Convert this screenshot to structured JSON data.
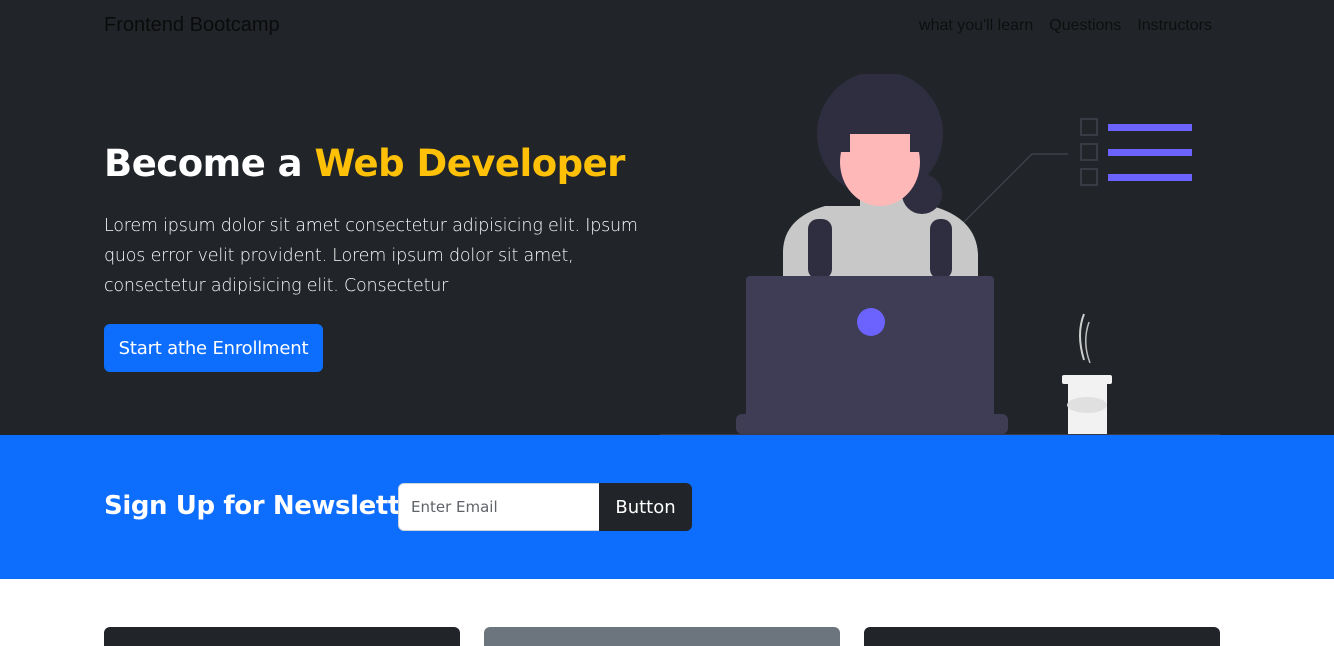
{
  "navbar": {
    "brand": "Frontend Bootcamp",
    "links": [
      "what you'll learn",
      "Questions",
      "Instructors"
    ]
  },
  "hero": {
    "title_prefix": "Become a ",
    "title_accent": "Web Developer",
    "lead": "Lorem ipsum dolor sit amet consectetur adipisicing elit. Ipsum quos error velit provident. Lorem ipsum dolor sit amet, consectetur adipisicing elit. Consectetur",
    "button_label": "Start athe Enrollment"
  },
  "newsletter": {
    "title": "Sign Up for Newsletter",
    "input_placeholder": "Enter Email",
    "button_label": "Button"
  },
  "colors": {
    "dark": "#212529",
    "primary": "#0d6efd",
    "warning": "#ffc107",
    "secondary": "#6c757d",
    "illustration_accent": "#6c63ff"
  }
}
